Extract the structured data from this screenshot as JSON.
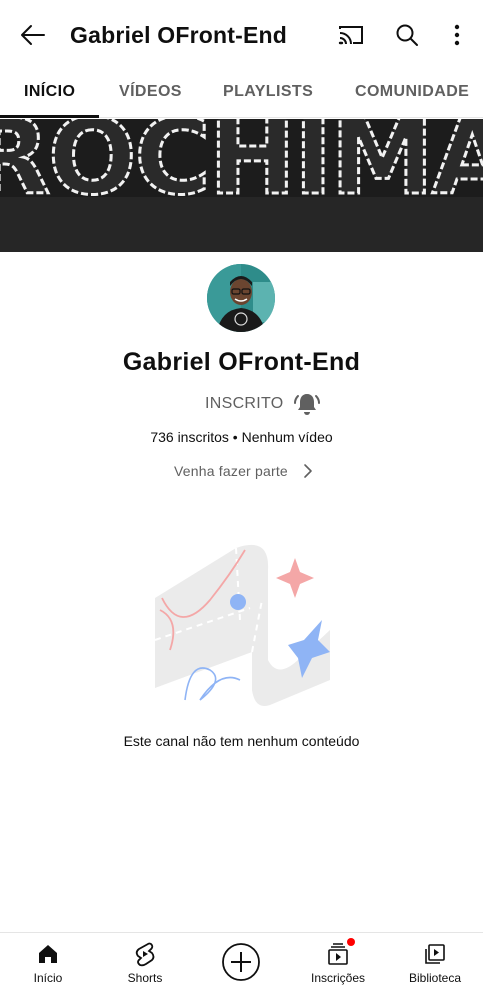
{
  "header": {
    "title": "Gabriel OFront-End",
    "icons": [
      "back-arrow-icon",
      "cast-icon",
      "search-icon",
      "more-vert-icon"
    ]
  },
  "tabs": [
    {
      "label": "INÍCIO",
      "active": true
    },
    {
      "label": "VÍDEOS",
      "active": false
    },
    {
      "label": "PLAYLISTS",
      "active": false
    },
    {
      "label": "COMUNIDADE",
      "active": false
    }
  ],
  "banner": {
    "text": "ROCHIMAR"
  },
  "channel": {
    "name": "Gabriel OFront-End",
    "subscribed_label": "INSCRITO",
    "stats": "736 inscritos • Nenhum vídeo",
    "join_label": "Venha fazer parte"
  },
  "empty_state": {
    "message": "Este canal não tem nenhum conteúdo"
  },
  "bottom_nav": [
    {
      "label": "Início",
      "icon": "home-icon"
    },
    {
      "label": "Shorts",
      "icon": "shorts-icon"
    },
    {
      "label": "",
      "icon": "create-plus-icon"
    },
    {
      "label": "Inscrições",
      "icon": "subscriptions-icon",
      "badge": true
    },
    {
      "label": "Biblioteca",
      "icon": "library-icon"
    }
  ],
  "colors": {
    "accent_red": "#ff0000",
    "text_primary": "#0f0f0f",
    "text_secondary": "#606060",
    "banner_bg": "#1f1f1f"
  }
}
